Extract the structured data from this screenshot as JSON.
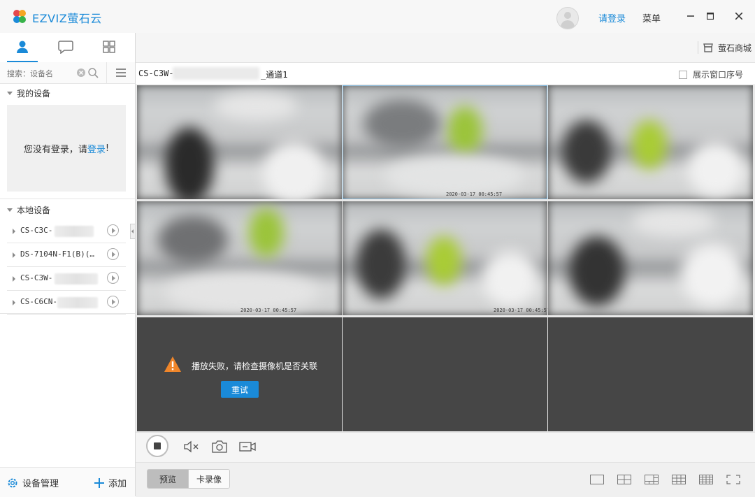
{
  "titlebar": {
    "brand": "EZVIZ萤石云",
    "login": "请登录",
    "menu": "菜单",
    "colors": {
      "accent": "#1a8ad8"
    }
  },
  "sidebar": {
    "tabs": [
      "user-icon",
      "chat-icon",
      "apps-grid-icon"
    ],
    "search": {
      "placeholder": "搜索：设备名"
    },
    "my_devices": {
      "title": "我的设备",
      "not_logged_prefix": "您没有登录，请",
      "login_link": "登录",
      "not_logged_suffix": "!"
    },
    "local_devices": {
      "title": "本地设备",
      "items": [
        {
          "label": "CS-C3C-"
        },
        {
          "label": "DS-7104N-F1(B)(…"
        },
        {
          "label": "CS-C3W-"
        },
        {
          "label": "CS-C6CN-"
        }
      ]
    },
    "footer": {
      "manage": "设备管理",
      "add": "添加"
    }
  },
  "main": {
    "store": "萤石商城",
    "channel": {
      "prefix": "CS-C3W-",
      "suffix": "_通道1"
    },
    "show_window_index": "展示窗口序号",
    "grid": {
      "timestamps": [
        "2020-03-17 00:45:57",
        "2020-03-17 00:45:57",
        "2020-03-17 00:45:57"
      ],
      "error_message": "播放失败，请检查摄像机是否关联",
      "retry": "重试"
    },
    "mode_tabs": [
      "预览",
      "卡录像"
    ]
  }
}
